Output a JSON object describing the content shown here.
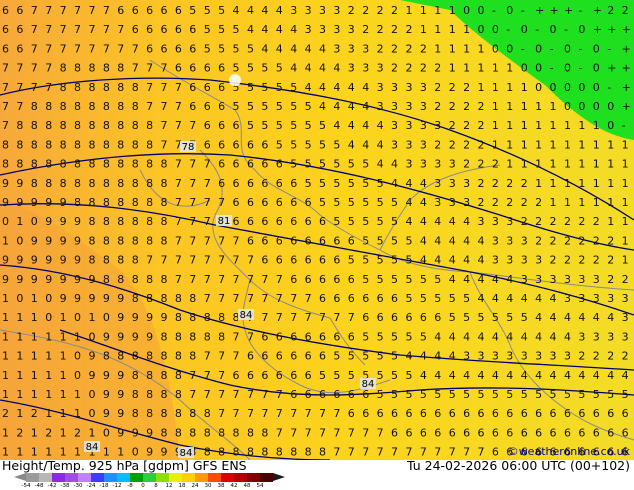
{
  "map": {
    "title": "Height/Temp. 925 hPa [gdpm] GFS ENS",
    "valid_time": "Tu 24-02-2026 06:00 UTC (00+102)",
    "credit": "©weatheronline.co.uk",
    "contour_labels": [
      "78",
      "81",
      "84",
      "84",
      "84",
      "84"
    ],
    "colors": {
      "field_main": "#fcd21c",
      "field_warm": "#f9b233",
      "field_cool": "#f6e530",
      "green_zone": "#1ee01e",
      "contour": "#000066",
      "border": "#8a8a8a"
    },
    "digit_grid": [
      "6677777766666555444433332222111100-0-+++-+22",
      "66777777766666555444433332222111100-0-0-0+++",
      "667777777766665555444443332222111100-0-0-0-+",
      "77778888877766665555444433322221111100-0-0++",
      "777788888877766655555444443333222111100000-+",
      "7788888888777666555555444433332222111110000+",
      "7888888888877766655555544443333222111111110-",
      "88888888888777666665555544433322221111111111",
      "88888888888877766666555555443333222111111111",
      "99888888888877766666655555544433322221111111",
      "99999888888877776666665555554433322222111111",
      "01099988888877776666666555554444433322222211",
      "10999988888877777666666665555444443332222221",
      "99999988887777777766666655555444443333222221",
      "99999998888877777777666665555554444433333322",
      "10109999988888777777776666665555544444433333",
      "11101010999988888777777776666665555554444443",
      "11111109999888887766666665555544444444443333",
      "11111098888888777666666555554444333333332222",
      "11111099988887776666665555555444444444444444",
      "11111109988887777777666666555555555555555555",
      "21211109988888877777777766666666666666666666",
      "12121210999888888887777777766666666666666666",
      "11111111109998888888888777777777776666666666"
    ]
  },
  "legend": {
    "ticks": [
      "-54",
      "-48",
      "-42",
      "-38",
      "-30",
      "-24",
      "-18",
      "-12",
      "-8",
      "0",
      "8",
      "12",
      "18",
      "24",
      "30",
      "38",
      "42",
      "48",
      "54"
    ],
    "colors": [
      "#9a9a9a",
      "#b7b7b7",
      "#8a2be2",
      "#a050e0",
      "#c080ff",
      "#3c3cff",
      "#1e90ff",
      "#00bfff",
      "#00a000",
      "#2ecc40",
      "#8ee000",
      "#e8f000",
      "#ffd000",
      "#ff9a00",
      "#ff4a00",
      "#e00000",
      "#b40000",
      "#800000",
      "#4a0000"
    ]
  }
}
